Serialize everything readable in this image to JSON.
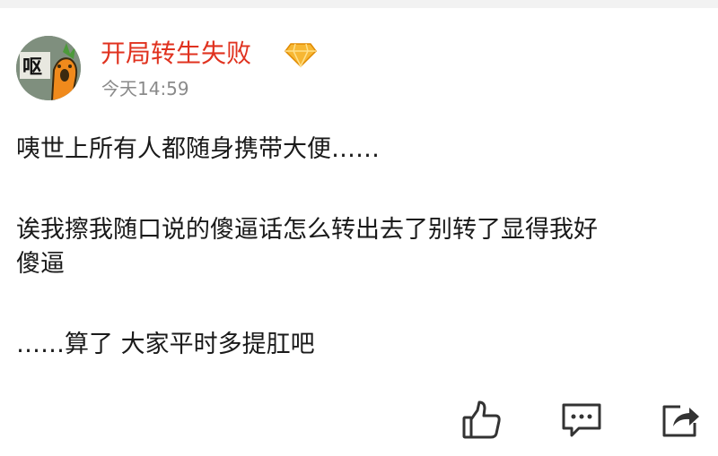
{
  "post": {
    "author": {
      "username": "开局转生失败",
      "avatar_text": "呕",
      "badge_icon": "vip-diamond-icon"
    },
    "timestamp": "今天14:59",
    "paragraphs": [
      [
        "咦世上所有人都随身携带大便……"
      ],
      [
        "诶我擦我随口说的傻逼话怎么转出去了别转了显得我好",
        "傻逼"
      ],
      [
        "……算了 大家平时多提肛吧"
      ]
    ]
  },
  "actions": [
    {
      "icon": "thumbs-up-icon"
    },
    {
      "icon": "comment-icon"
    },
    {
      "icon": "share-icon"
    }
  ],
  "colors": {
    "username": "#e0321f",
    "timestamp": "#8a8a8a",
    "body_text": "#1a1a1a",
    "icon": "#333333",
    "badge": "#f5a623"
  }
}
